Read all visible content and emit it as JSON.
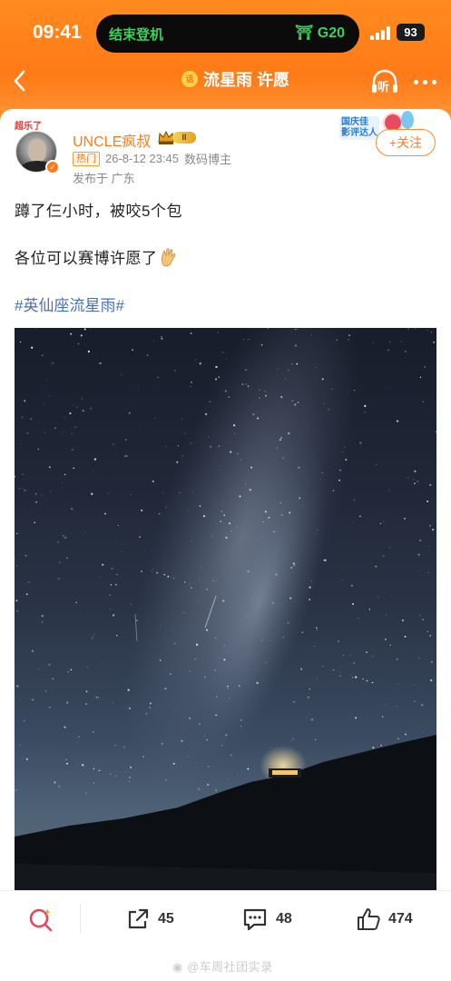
{
  "status_bar": {
    "time": "09:41",
    "live_activity_left": "结束登机",
    "live_activity_right": "G20",
    "battery": "93"
  },
  "nav": {
    "title": "流星雨 许愿",
    "listen_label": "听",
    "topic_icon_text": "话"
  },
  "post": {
    "avatar_deco": "超乐了",
    "username": "UNCLE疯叔",
    "level_badge": "II",
    "hot_tag": "热门",
    "timestamp": "26-8-12 23:45",
    "author_title": "数码博主",
    "location": "发布于 广东",
    "event_badge_text": "国庆佳\n影评达人",
    "follow_label": "+关注",
    "line1": "蹲了仨小时，被咬5个包",
    "line2": "各位可以赛博许愿了",
    "hashtag": "#英仙座流星雨#"
  },
  "actions": {
    "share_count": "45",
    "comment_count": "48",
    "like_count": "474"
  },
  "watermark": "@车周社团实录",
  "colors": {
    "brand_orange": "#ff7a18",
    "hashtag_blue": "#4a6fb5"
  }
}
